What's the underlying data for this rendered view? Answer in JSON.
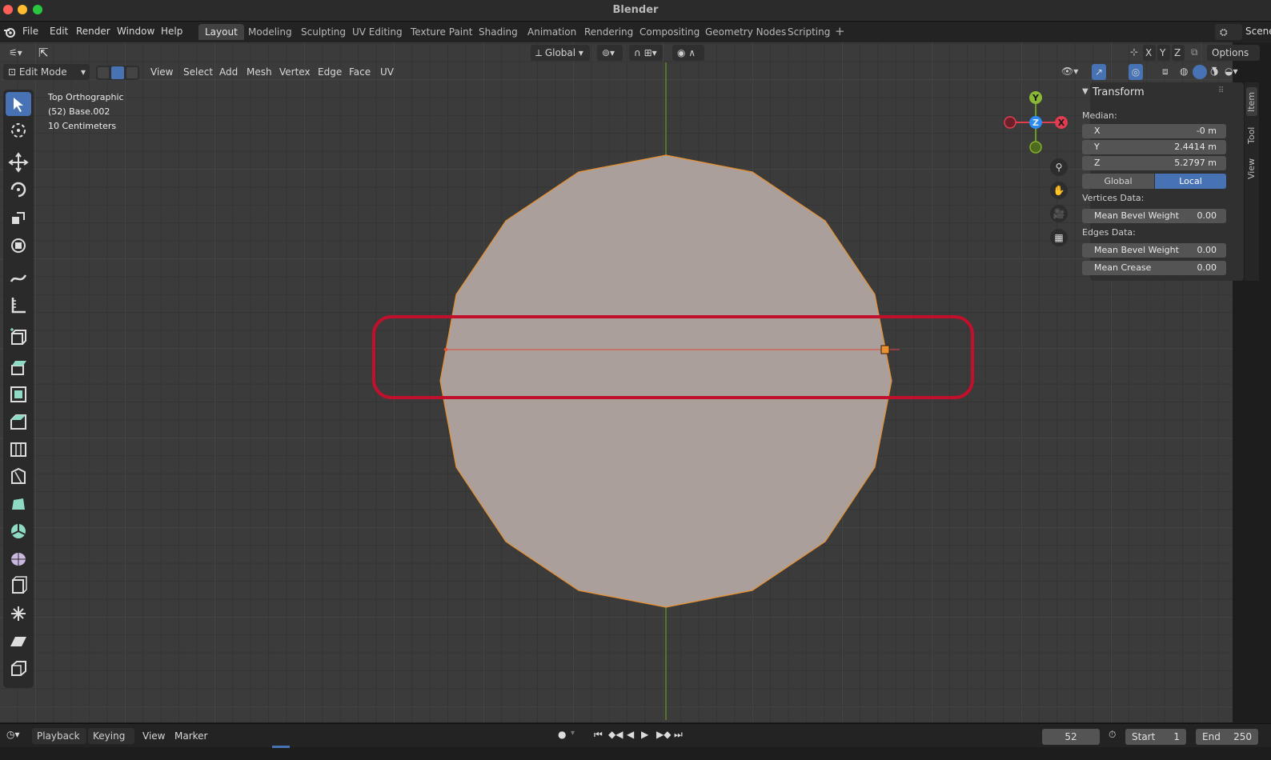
{
  "window": {
    "title": "Blender"
  },
  "menus": [
    "File",
    "Edit",
    "Render",
    "Window",
    "Help"
  ],
  "workspaces": [
    "Layout",
    "Modeling",
    "Sculpting",
    "UV Editing",
    "Texture Paint",
    "Shading",
    "Animation",
    "Rendering",
    "Compositing",
    "Geometry Nodes",
    "Scripting"
  ],
  "active_workspace": "Layout",
  "scene_label": "Scene",
  "header": {
    "orientation": "Global",
    "axes": [
      "X",
      "Y",
      "Z"
    ],
    "options_label": "Options",
    "mode": "Edit Mode",
    "viewport_menus": [
      "View",
      "Select",
      "Add",
      "Mesh",
      "Vertex",
      "Edge",
      "Face",
      "UV"
    ]
  },
  "overlay_text": {
    "view_name": "Top Orthographic",
    "object_name": "(52) Base.002",
    "grid_scale": "10 Centimeters"
  },
  "gizmo": {
    "y": "Y",
    "z": "Z",
    "x": "X"
  },
  "transform_panel": {
    "title": "Transform",
    "median_label": "Median:",
    "x_label": "X",
    "x_value": "-0 m",
    "y_label": "Y",
    "y_value": "2.4414 m",
    "z_label": "Z",
    "z_value": "5.2797 m",
    "global_label": "Global",
    "local_label": "Local",
    "vertices_data_label": "Vertices Data:",
    "vertex_bevel_label": "Mean Bevel Weight",
    "vertex_bevel_value": "0.00",
    "edges_data_label": "Edges Data:",
    "edge_bevel_label": "Mean Bevel Weight",
    "edge_bevel_value": "0.00",
    "crease_label": "Mean Crease",
    "crease_value": "0.00"
  },
  "side_tabs": [
    "Item",
    "Tool",
    "View"
  ],
  "timeline": {
    "menus": [
      "Playback",
      "Keying",
      "View",
      "Marker"
    ],
    "current_frame": "52",
    "start_label": "Start",
    "start_value": "1",
    "end_label": "End",
    "end_value": "250"
  },
  "colors": {
    "accent": "#4772b3",
    "mesh_face": "#ab9f9c",
    "mesh_edge": "#e8912f",
    "highlight_box": "#c2102c",
    "axis_green": "#6a9a22",
    "axis_red": "#e13c50",
    "axis_blue": "#2a8cf0"
  }
}
